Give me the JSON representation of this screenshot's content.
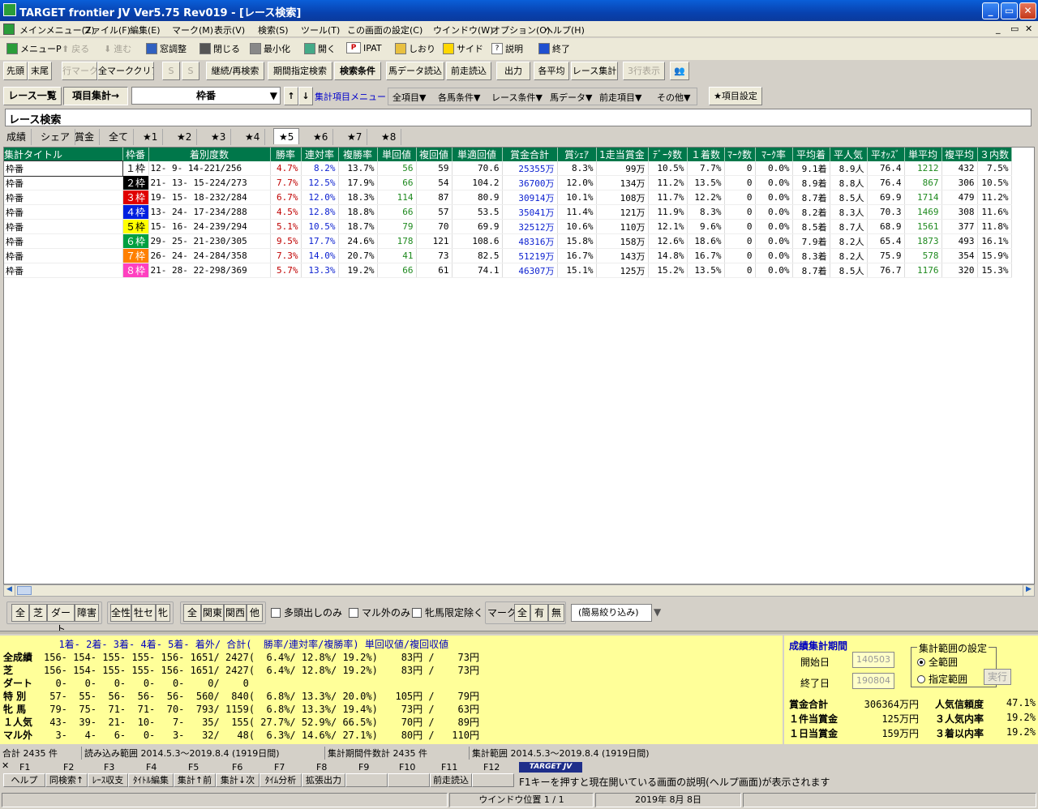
{
  "window": {
    "title": "TARGET frontier JV  Ver5.75  Rev019 - [レース検索]"
  },
  "menu": [
    "メインメニュー(Z)",
    "ファイル(F)",
    "編集(E)",
    "マーク(M)",
    "表示(V)",
    "検索(S)",
    "ツール(T)",
    "この画面の設定(C)",
    "ウインドウ(W)",
    "オプション(O)",
    "ヘルプ(H)"
  ],
  "toolbar1": [
    {
      "label": "メニューP",
      "icon": "menu-icon",
      "enabled": true
    },
    {
      "label": "戻る",
      "icon": "back-arrow-icon",
      "enabled": false
    },
    {
      "label": "進む",
      "icon": "forward-arrow-icon",
      "enabled": false
    },
    {
      "label": "窓調整",
      "icon": "window-icon",
      "enabled": true
    },
    {
      "label": "閉じる",
      "icon": "close-door-icon",
      "enabled": true
    },
    {
      "label": "最小化",
      "icon": "minimize-icon",
      "enabled": true
    },
    {
      "label": "開く",
      "icon": "open-icon",
      "enabled": true
    },
    {
      "label": "IPAT",
      "icon": "pat-icon",
      "enabled": true
    },
    {
      "label": "しおり",
      "icon": "bookmark-icon",
      "enabled": true
    },
    {
      "label": "サイド",
      "icon": "side-icon",
      "enabled": true
    },
    {
      "label": "説明",
      "icon": "help-icon",
      "enabled": true
    },
    {
      "label": "終了",
      "icon": "exit-icon",
      "enabled": true
    }
  ],
  "toolbar2": {
    "head": "先頭",
    "tail": "末尾",
    "rowmark": "行マーク",
    "clearmark": "全マーククリア",
    "s1": "S",
    "s2": "S",
    "research": "継続/再検索",
    "period_search": "期間指定検索",
    "search_cond": "検索条件",
    "horse_data": "馬データ読込",
    "prev_race": "前走読込",
    "output": "出力",
    "avg": "各平均",
    "race_total": "レース集計",
    "rows3": "3行表示"
  },
  "toolbar3": {
    "race_list": "レース一覧",
    "item_total": "項目集計→",
    "combo_value": "枠番",
    "up": "↑",
    "down": "↓",
    "total_menu": "集計項目メニュー",
    "all_items": "全項目▼",
    "horse_cond": "各馬条件▼",
    "race_cond": "レース条件▼",
    "horse_data": "馬データ▼",
    "prev_item": "前走項目▼",
    "other": "その他▼",
    "item_settings": "★項目設定"
  },
  "search_label": "レース検索",
  "tabs": [
    "成績",
    "シェア",
    "賞金",
    "全て",
    "★1",
    "★2",
    "★3",
    "★4",
    "★5",
    "★6",
    "★7",
    "★8"
  ],
  "selected_tab": "★5",
  "table": {
    "headers": [
      "集計タイトル",
      "枠番",
      "着別度数",
      "勝率",
      "連対率",
      "複勝率",
      "単回値",
      "複回値",
      "単適回値",
      "賞金合計",
      "賞ｼｪｱ",
      "1走当賞金",
      "ﾃﾞｰﾀ数",
      "１着数",
      "ﾏｰｸ数",
      "ﾏｰｸ率",
      "平均着",
      "平人気",
      "平ｵｯｽﾞ",
      "単平均",
      "複平均",
      "３内数"
    ],
    "rows": [
      [
        "枠番",
        "１枠",
        "12-  9- 14-221/256",
        "4.7%",
        "8.2%",
        "13.7%",
        "56",
        "59",
        "70.6",
        "25355万",
        "8.3%",
        "99万",
        "10.5%",
        "7.7%",
        "0",
        "0.0%",
        "9.1着",
        "8.9人",
        "76.4",
        "1212",
        "432",
        "7.5%"
      ],
      [
        "枠番",
        "２枠",
        "21- 13- 15-224/273",
        "7.7%",
        "12.5%",
        "17.9%",
        "66",
        "54",
        "104.2",
        "36700万",
        "12.0%",
        "134万",
        "11.2%",
        "13.5%",
        "0",
        "0.0%",
        "8.9着",
        "8.8人",
        "76.4",
        "867",
        "306",
        "10.5%"
      ],
      [
        "枠番",
        "３枠",
        "19- 15- 18-232/284",
        "6.7%",
        "12.0%",
        "18.3%",
        "114",
        "87",
        "80.9",
        "30914万",
        "10.1%",
        "108万",
        "11.7%",
        "12.2%",
        "0",
        "0.0%",
        "8.7着",
        "8.5人",
        "69.9",
        "1714",
        "479",
        "11.2%"
      ],
      [
        "枠番",
        "４枠",
        "13- 24- 17-234/288",
        "4.5%",
        "12.8%",
        "18.8%",
        "66",
        "57",
        "53.5",
        "35041万",
        "11.4%",
        "121万",
        "11.9%",
        "8.3%",
        "0",
        "0.0%",
        "8.2着",
        "8.3人",
        "70.3",
        "1469",
        "308",
        "11.6%"
      ],
      [
        "枠番",
        "５枠",
        "15- 16- 24-239/294",
        "5.1%",
        "10.5%",
        "18.7%",
        "79",
        "70",
        "69.9",
        "32512万",
        "10.6%",
        "110万",
        "12.1%",
        "9.6%",
        "0",
        "0.0%",
        "8.5着",
        "8.7人",
        "68.9",
        "1561",
        "377",
        "11.8%"
      ],
      [
        "枠番",
        "６枠",
        "29- 25- 21-230/305",
        "9.5%",
        "17.7%",
        "24.6%",
        "178",
        "121",
        "108.6",
        "48316万",
        "15.8%",
        "158万",
        "12.6%",
        "18.6%",
        "0",
        "0.0%",
        "7.9着",
        "8.2人",
        "65.4",
        "1873",
        "493",
        "16.1%"
      ],
      [
        "枠番",
        "７枠",
        "26- 24- 24-284/358",
        "7.3%",
        "14.0%",
        "20.7%",
        "41",
        "73",
        "82.5",
        "51219万",
        "16.7%",
        "143万",
        "14.8%",
        "16.7%",
        "0",
        "0.0%",
        "8.3着",
        "8.2人",
        "75.9",
        "578",
        "354",
        "15.9%"
      ],
      [
        "枠番",
        "８枠",
        "21- 28- 22-298/369",
        "5.7%",
        "13.3%",
        "19.2%",
        "66",
        "61",
        "74.1",
        "46307万",
        "15.1%",
        "125万",
        "15.2%",
        "13.5%",
        "0",
        "0.0%",
        "8.7着",
        "8.5人",
        "76.7",
        "1176",
        "320",
        "15.3%"
      ]
    ],
    "waku_colors": [
      {
        "bg": "#ffffff",
        "fg": "#000000"
      },
      {
        "bg": "#000000",
        "fg": "#ffffff"
      },
      {
        "bg": "#e00000",
        "fg": "#ffffff"
      },
      {
        "bg": "#0020e0",
        "fg": "#ffffff"
      },
      {
        "bg": "#ffff00",
        "fg": "#000000"
      },
      {
        "bg": "#00a040",
        "fg": "#ffffff"
      },
      {
        "bg": "#ff8000",
        "fg": "#ffffff"
      },
      {
        "bg": "#ff40c0",
        "fg": "#ffffff"
      }
    ]
  },
  "filters": {
    "all": "全",
    "turf": "芝",
    "dirt": "ダート",
    "hurdle": "障害",
    "all_sex": "全性",
    "male": "牡セ",
    "female": "牝",
    "all_region": "全",
    "kanto": "関東",
    "kansai": "関西",
    "other": "他",
    "multi_only": "多頭出しのみ",
    "maru_only": "マル外のみ",
    "exclude_female_only": "牝馬限定除く",
    "mark": "マーク",
    "mark_all": "全",
    "mark_yes": "有",
    "mark_no": "無",
    "simple_filter": "(簡易絞り込み)"
  },
  "stats": {
    "header": "  1着- 2着- 3着- 4着- 5着- 着外/ 合計(  勝率/連対率/複勝率) 単回収値/複回収値",
    "rows": [
      {
        "label": "全成績",
        "text": "156- 154- 155- 155- 156- 1651/ 2427(  6.4%/ 12.8%/ 19.2%)    83円 /    73円"
      },
      {
        "label": "芝",
        "text": "156- 154- 155- 155- 156- 1651/ 2427(  6.4%/ 12.8%/ 19.2%)    83円 /    73円"
      },
      {
        "label": "ダート",
        "text": "  0-   0-   0-   0-   0-    0/    0"
      },
      {
        "label": "特 別",
        "text": " 57-  55-  56-  56-  56-  560/  840(  6.8%/ 13.3%/ 20.0%)   105円 /    79円"
      },
      {
        "label": "牝 馬",
        "text": " 79-  75-  71-  71-  70-  793/ 1159(  6.8%/ 13.3%/ 19.4%)    73円 /    63円"
      },
      {
        "label": "１人気",
        "text": " 43-  39-  21-  10-   7-   35/  155( 27.7%/ 52.9%/ 66.5%)    70円 /    89円"
      },
      {
        "label": "マル外",
        "text": "  3-   4-   6-   0-   3-   32/   48(  6.3%/ 14.6%/ 27.1%)    80円 /   110円"
      }
    ]
  },
  "period": {
    "title": "成績集計期間",
    "start_label": "開始日",
    "start_value": "140503",
    "end_label": "終了日",
    "end_value": "190804",
    "range_title": "集計範囲の設定",
    "range_all": "全範囲",
    "range_custom": "指定範囲",
    "run": "実行",
    "prize_total_label": "賞金合計",
    "prize_total": "306364万円",
    "per_race_label": "１件当賞金",
    "per_race": "125万円",
    "per_day_label": "１日当賞金",
    "per_day": "159万円",
    "pop_rel_label": "人気信頼度",
    "pop_rel": "47.1%",
    "top3_pop_label": "３人気内率",
    "top3_pop": "19.2%",
    "top3_finish_label": "３着以内率",
    "top3_finish": "19.2%"
  },
  "status": {
    "total": "合計 2435 件",
    "read_range": "読み込み範囲 2014.5.3～2019.8.4 (1919日間)",
    "period_count": "集計期間件数計 2435 件",
    "total_range": "集計範囲 2014.5.3～2019.8.4 (1919日間)"
  },
  "fkeys": {
    "labels": [
      "F1",
      "F2",
      "F3",
      "F4",
      "F5",
      "F6",
      "F7",
      "F8",
      "F9",
      "F10",
      "F11",
      "F12"
    ],
    "buttons": [
      "ヘルプ",
      "同検索↑",
      "ﾚｰｽ収支",
      "ﾀｲﾄﾙ編集",
      "集計↑前",
      "集計↓次",
      "ﾀｲﾑ分析",
      "拡張出力",
      "",
      "",
      "前走読込",
      ""
    ],
    "logo": "TARGET JV",
    "hint": "F1キーを押すと現在開いている画面の説明(ヘルプ画面)が表示されます"
  },
  "bottom": {
    "window_pos": "ウインドウ位置 1 / 1",
    "date": "2019年 8月 8日"
  }
}
